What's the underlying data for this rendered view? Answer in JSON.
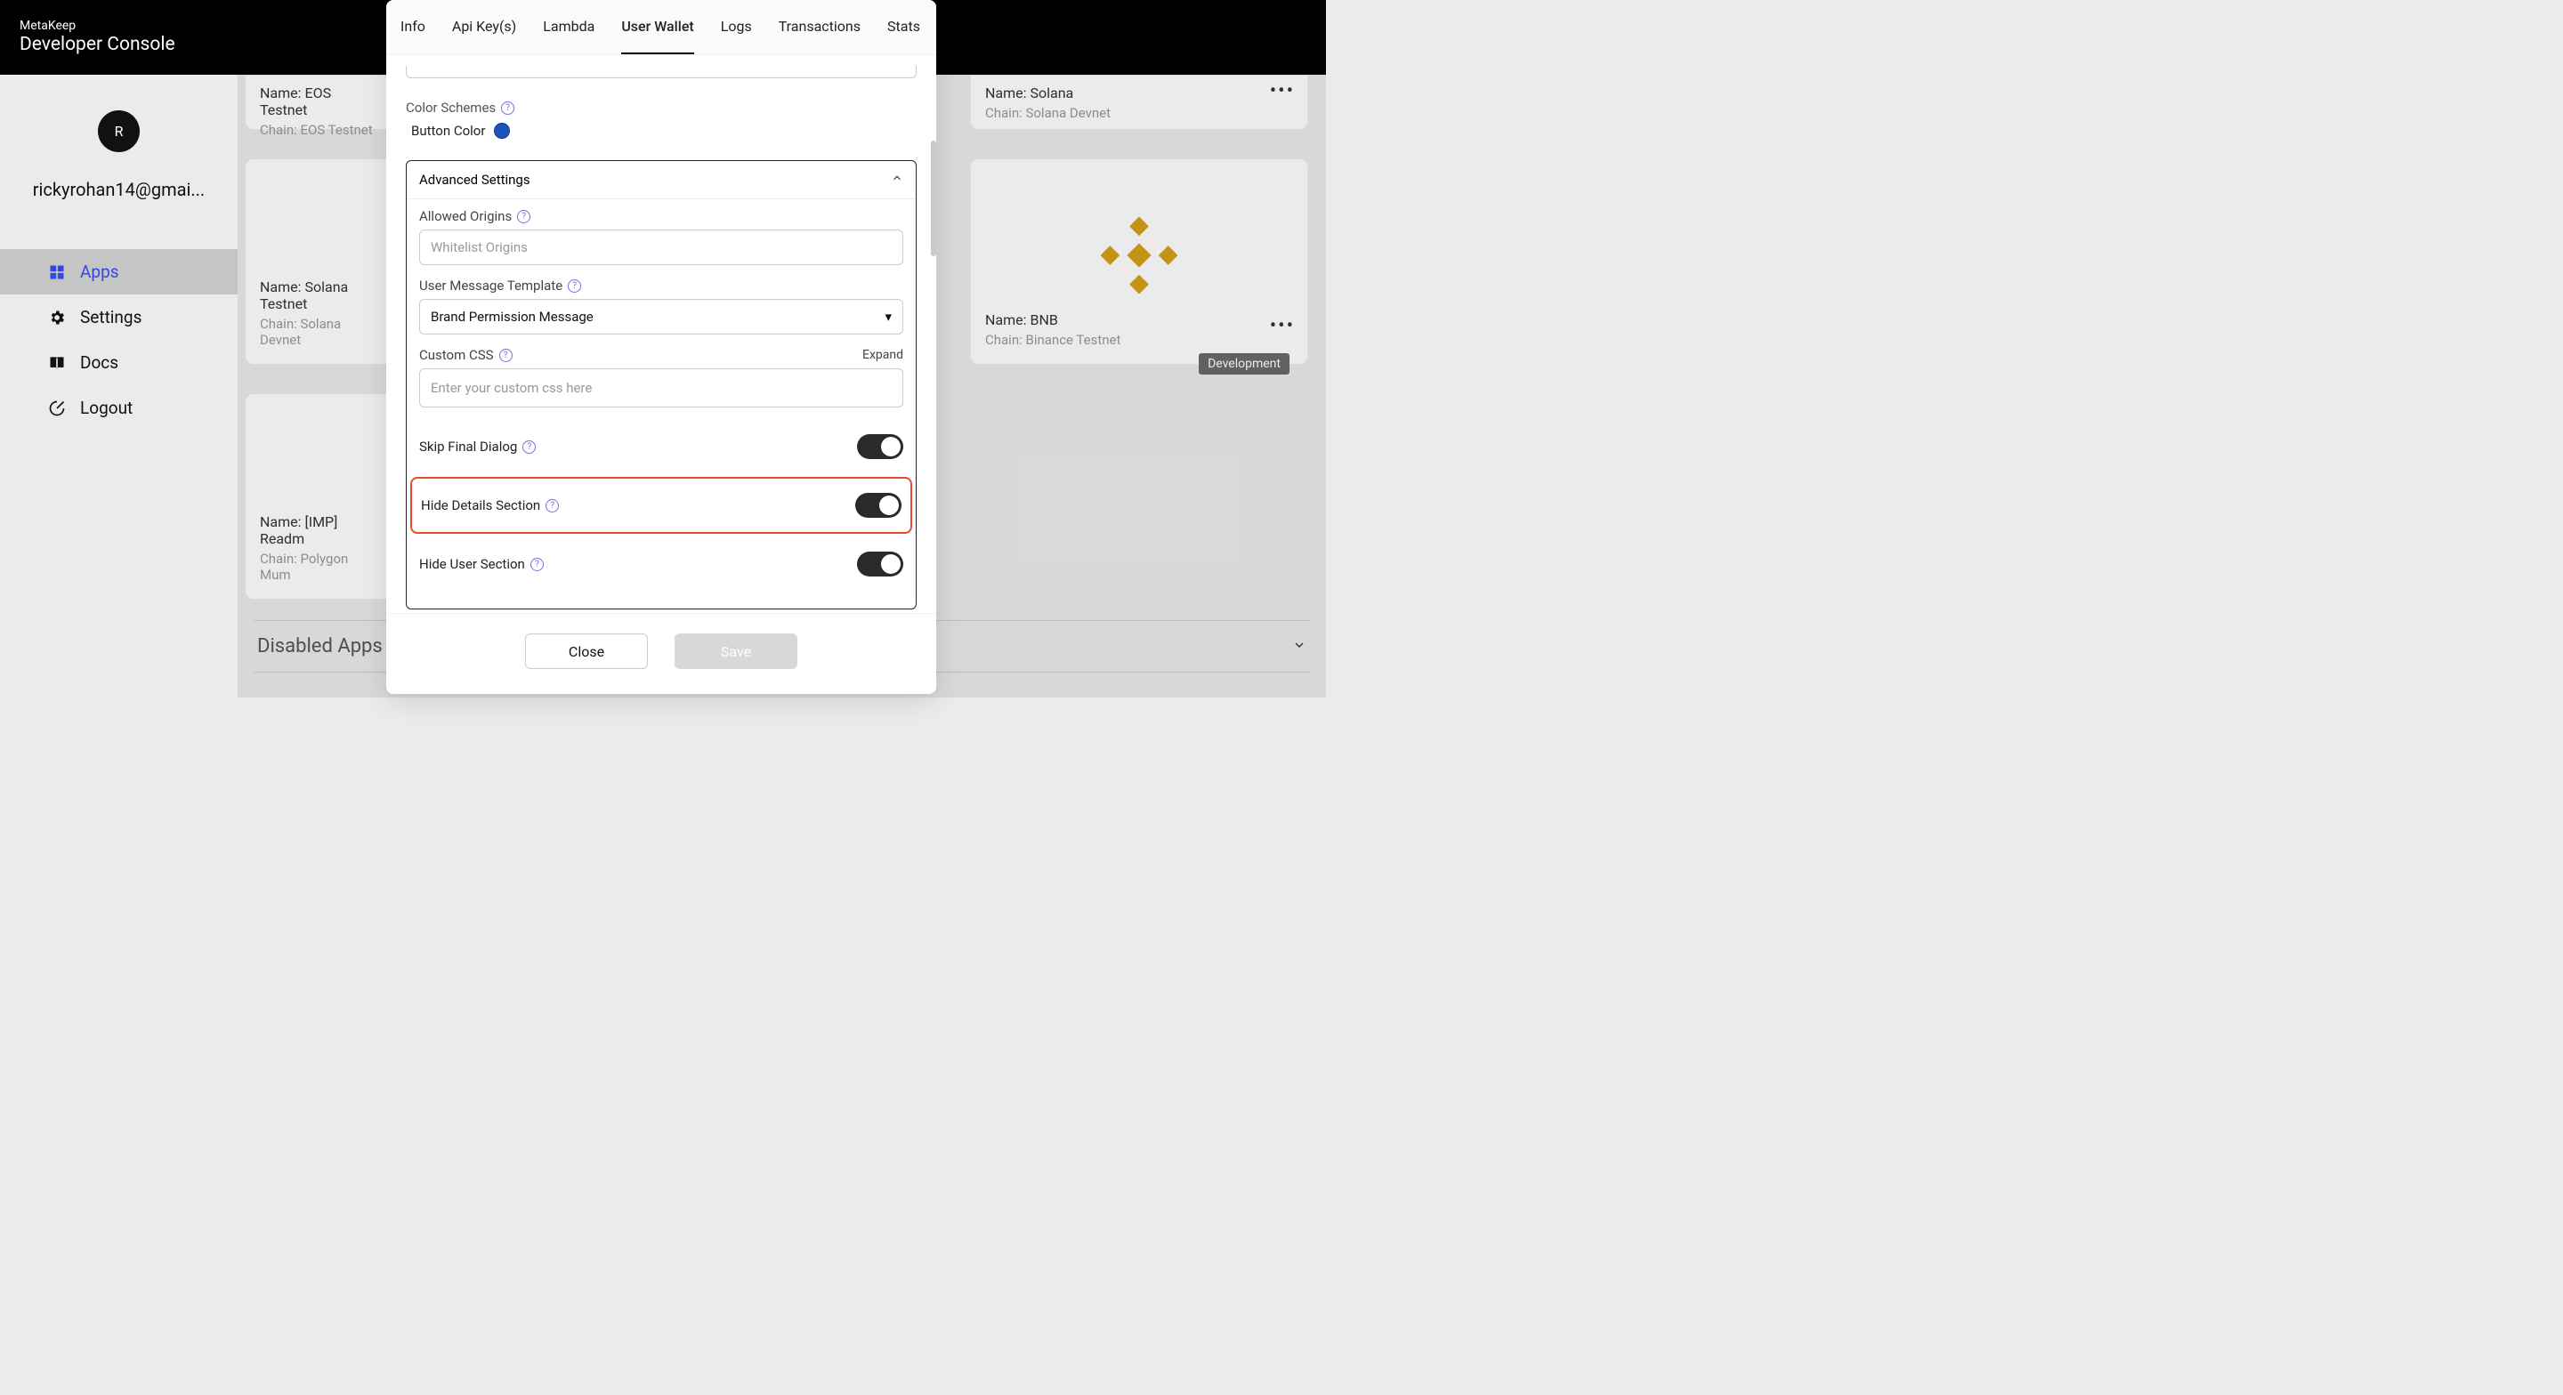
{
  "header": {
    "brand": "MetaKeep",
    "sub": "Developer Console"
  },
  "sidebar": {
    "avatar_letter": "R",
    "email": "rickyrohan14@gmai...",
    "nav": [
      {
        "label": "Apps",
        "icon": "grid-icon",
        "active": true
      },
      {
        "label": "Settings",
        "icon": "gear-icon",
        "active": false
      },
      {
        "label": "Docs",
        "icon": "book-icon",
        "active": false
      },
      {
        "label": "Logout",
        "icon": "logout-icon",
        "active": false
      }
    ]
  },
  "cards": {
    "eos": {
      "name": "Name: EOS Testnet",
      "chain": "Chain: EOS Testnet"
    },
    "solana_testnet": {
      "name": "Name: Solana Testnet",
      "chain": "Chain: Solana Devnet"
    },
    "readm": {
      "name": "Name: [IMP] Readm",
      "chain": "Chain: Polygon Mum"
    },
    "solana": {
      "name": "Name: Solana",
      "chain": "Chain: Solana Devnet"
    },
    "bnb": {
      "name": "Name: BNB",
      "chain": "Chain: Binance Testnet"
    },
    "dev_badge": "Development"
  },
  "disabled_apps_label": "Disabled Apps",
  "modal": {
    "tabs": [
      "Info",
      "Api Key(s)",
      "Lambda",
      "User Wallet",
      "Logs",
      "Transactions",
      "Stats"
    ],
    "active_tab": "User Wallet",
    "color_schemes_label": "Color Schemes",
    "button_color_label": "Button Color",
    "button_color_value": "#1d52bd",
    "accordion_title": "Advanced Settings",
    "allowed_origins": {
      "label": "Allowed Origins",
      "placeholder": "Whitelist Origins",
      "value": ""
    },
    "user_message_template": {
      "label": "User Message Template",
      "selected": "Brand Permission Message"
    },
    "custom_css": {
      "label": "Custom CSS",
      "expand_label": "Expand",
      "placeholder": "Enter your custom css here",
      "value": ""
    },
    "toggles": {
      "skip_final_dialog": {
        "label": "Skip Final Dialog",
        "on": true
      },
      "hide_details_section": {
        "label": "Hide Details Section",
        "on": true
      },
      "hide_user_section": {
        "label": "Hide User Section",
        "on": true
      }
    },
    "buttons": {
      "close": "Close",
      "save": "Save"
    }
  }
}
